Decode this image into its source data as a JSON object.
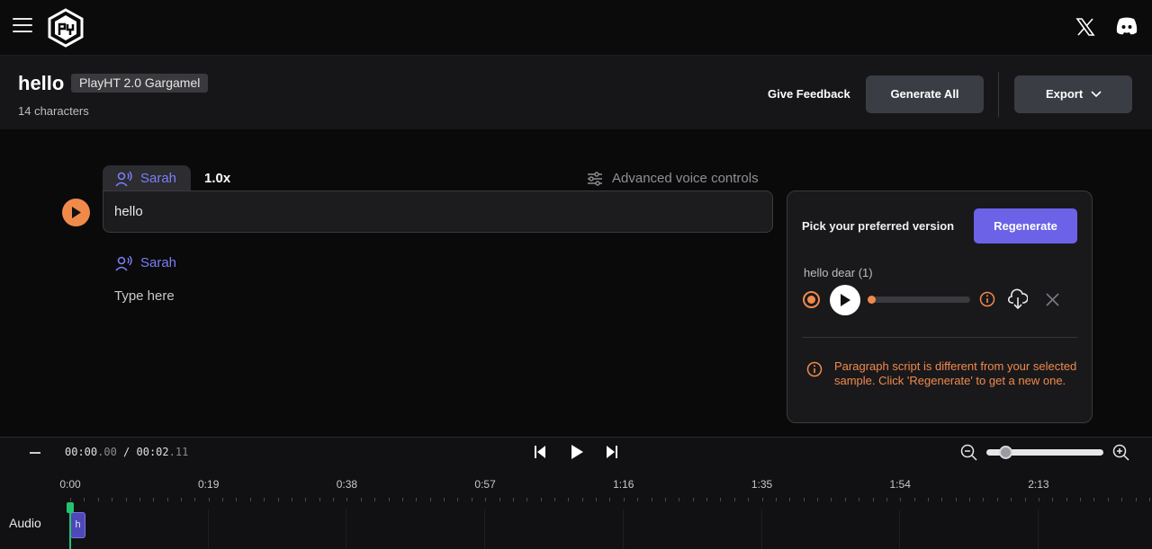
{
  "nav": {
    "logo": "logo-icon",
    "x_icon": "x-twitter-icon",
    "discord_icon": "discord-icon"
  },
  "project": {
    "title": "hello",
    "badge": "PlayHT 2.0 Gargamel",
    "char_count": "14 characters",
    "feedback_label": "Give Feedback",
    "generate_all_label": "Generate All",
    "export_label": "Export"
  },
  "editor": {
    "paragraphs": [
      {
        "voice": "Sarah",
        "speed": "1.0x",
        "text": "hello"
      },
      {
        "voice": "Sarah",
        "placeholder": "Type here"
      }
    ],
    "advanced_label": "Advanced voice controls"
  },
  "version_panel": {
    "title": "Pick your preferred version",
    "regenerate_label": "Regenerate",
    "sample_name": "hello dear (1)",
    "warning": "Paragraph script is different from your selected sample. Click 'Regenerate' to get a new one."
  },
  "timeline": {
    "current_main": "00:00",
    "current_ms": ".00",
    "separator": " / ",
    "total_main": "00:02",
    "total_ms": ".11",
    "ticks": [
      "0:00",
      "0:19",
      "0:38",
      "0:57",
      "1:16",
      "1:35",
      "1:54",
      "2:13"
    ],
    "track_label": "Audio",
    "clip_label": "h",
    "progress": 0
  },
  "colors": {
    "accent": "#f08a4b",
    "voice": "#7b7ff5",
    "regenerate": "#6b62e8",
    "playhead": "#25c26e"
  }
}
